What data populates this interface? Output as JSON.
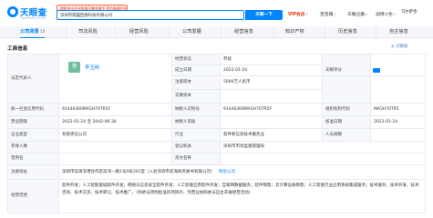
{
  "header": {
    "logo_text": "天眼查",
    "logo_sub": "TianYanCha.com",
    "promo": "国家中小企业发展子基金旗下 官方备案企业征信机构",
    "search_value": "深圳市雨露回春科技有限公司",
    "search_tags": "",
    "search_button": "天眼一下",
    "nav": [
      "VIP会员",
      "百宝箱",
      "天眼企服",
      "润博小生",
      "马尔萨金"
    ]
  },
  "tabs": [
    {
      "label": "公司背景",
      "count": "15",
      "active": true
    },
    {
      "label": "司法风险",
      "count": "",
      "active": false
    },
    {
      "label": "经营风险",
      "count": "",
      "active": false
    },
    {
      "label": "公司发展",
      "count": "",
      "active": false
    },
    {
      "label": "经营信息",
      "count": "",
      "active": false
    },
    {
      "label": "知识产权",
      "count": "",
      "active": false
    },
    {
      "label": "历史信息",
      "count": "",
      "active": false
    },
    {
      "label": "自主信息",
      "count": "",
      "active": false
    }
  ],
  "section": {
    "title": "工商信息",
    "logo": "天眼查"
  },
  "business_info": {
    "legal_rep_label": "法定代表人",
    "legal_rep_avatar": "李",
    "legal_rep_name": "李玉彬",
    "status_label": "经营状态",
    "status_value": "存续",
    "tianyan_label": "天眼评分",
    "established_label": "成立日期",
    "established_value": "2022-01-24",
    "approved_label": "核准日期",
    "reg_capital_label": "注册资本",
    "reg_capital_value": "5000万人民币",
    "paid_capital_label": "实缴资本",
    "credit_code_label": "统一社会信用代码",
    "credit_code_value": "91440300MA5H70TR5F",
    "tax_id_label": "纳税人识别号",
    "tax_id_value": "91440300MA5H70TR5F",
    "org_code_label": "组织机构代码",
    "org_code_value": "MA5H70TR5",
    "term_label": "营业期限",
    "term_value": "2022-01-24 至 2042-06-30",
    "taxpayer_label": "纳税人资质",
    "approved_value": "2022-01-24",
    "type_label": "企业类型",
    "type_value": "有限责任公司",
    "industry_label": "行业",
    "industry_value": "软件和信息技术服务业",
    "staff_label": "人员规模",
    "insured_label": "参保人数",
    "authority_label": "登记机关",
    "authority_value": "深圳市市场监督管理局",
    "former_name_label": "曾用名",
    "en_name_label": "英文名称",
    "address_label": "注册地址",
    "address_value": "深圳市前海深港合作区前湾一路1号A栋201室（入驻深圳市前海商务秘书有限公司）",
    "address_link": "附近公司",
    "scope_label": "经营范围",
    "scope_value": "软件开发；人工智能基础软件开发；网络与信息安全软件开发；人工智能应用软件开发；互联网数据服务；软件销售；云计算设备销售；人工智能行业应用系统集成服务；技术服务、技术开发、技术咨询、技术交流、技术转让、技术推广。（除依法须经批准的项目外，凭营业执照依法自主开展经营活动）"
  },
  "colors": {
    "brand": "#0084ff",
    "promo": "#e8320f",
    "label_bg": "#f6f8fb"
  }
}
